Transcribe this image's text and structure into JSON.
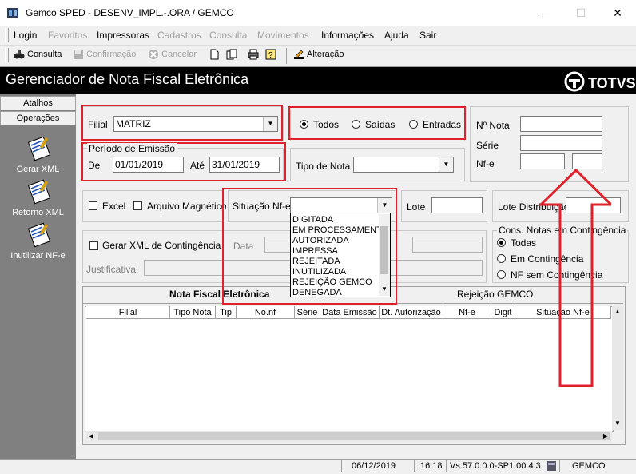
{
  "window": {
    "title": "Gemco SPED - DESENV_IMPL.-.ORA / GEMCO",
    "minimize": "—",
    "maximize": "☐",
    "close": "✕"
  },
  "menu": [
    "Login",
    "Favoritos",
    "Impressoras",
    "Cadastros",
    "Consulta",
    "Movimentos",
    "Informações",
    "Ajuda",
    "Sair"
  ],
  "toolbar": {
    "consulta": "Consulta",
    "confirmacao": "Confirmação",
    "cancelar": "Cancelar",
    "alteracao": "Alteração"
  },
  "header": {
    "title": "Gerenciador de Nota Fiscal Eletrônica",
    "logo": "TOTVS"
  },
  "sidebar": {
    "tabs": [
      "Atalhos",
      "Operações"
    ],
    "items": [
      "Gerar XML",
      "Retorno XML",
      "Inutilizar NF-e"
    ]
  },
  "form": {
    "filial_label": "Filial",
    "filial_value": "MATRIZ",
    "periodo_title": "Período de Emissão",
    "de_label": "De",
    "de_value": "01/01/2019",
    "ate_label": "Até",
    "ate_value": "31/01/2019",
    "radio_todos": "Todos",
    "radio_saidas": "Saídas",
    "radio_entradas": "Entradas",
    "tipo_nota_label": "Tipo de Nota",
    "num_nota_label": "Nº Nota",
    "serie_label": "Série",
    "nfe_label": "Nf-e",
    "excel_label": "Excel",
    "arquivo_label": "Arquivo Magnético",
    "situacao_label": "Situação Nf-e",
    "lote_label": "Lote",
    "lote_dist_label": "Lote Distribuição",
    "contingencia_label": "Gerar XML de Contingência",
    "data_label": "Data",
    "justificativa_label": "Justificativa",
    "cons_title": "Cons. Notas em Contingência",
    "cons_todas": "Todas",
    "cons_em": "Em Contingência",
    "cons_sem": "NF sem Contingência"
  },
  "situacao_options": [
    "DIGITADA",
    "EM PROCESSAMENT",
    "AUTORIZADA",
    "IMPRESSA",
    "REJEITADA",
    "INUTILIZADA",
    "REJEIÇÃO GEMCO",
    "DENEGADA"
  ],
  "grid": {
    "tab_nfe": "Nota Fiscal Eletrônica",
    "tab_rej": "Rejeição GEMCO",
    "columns": [
      "Filial",
      "Tipo Nota",
      "Tip",
      "No.nf",
      "Série",
      "Data Emissão",
      "Dt. Autorização",
      "Nf-e",
      "Digit",
      "Situação Nf-e"
    ]
  },
  "status": {
    "date": "06/12/2019",
    "time": "16:18",
    "version": "Vs.57.0.0.0-SP1.00.4.3",
    "company": "GEMCO"
  }
}
